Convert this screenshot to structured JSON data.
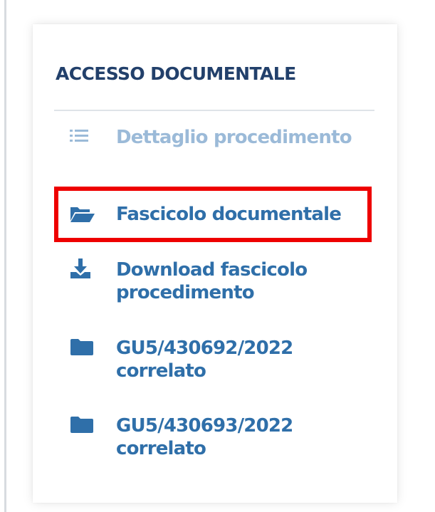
{
  "panel": {
    "title": "ACCESSO DOCUMENTALE",
    "items": [
      {
        "label": "Dettaglio procedimento",
        "icon": "list-icon",
        "state": "disabled"
      },
      {
        "label": "Fascicolo documentale",
        "icon": "folder-open-icon",
        "state": "highlighted"
      },
      {
        "label": "Download fascicolo procedimento",
        "icon": "download-icon",
        "state": "normal"
      },
      {
        "label": "GU5/430692/2022 correlato",
        "icon": "folder-icon",
        "state": "normal"
      },
      {
        "label": "GU5/430693/2022 correlato",
        "icon": "folder-icon",
        "state": "normal"
      }
    ]
  },
  "colors": {
    "title": "#22406b",
    "link": "#2f6fa9",
    "disabled": "#9bbad8",
    "highlight": "#ee0000",
    "divider": "#dfe3e8"
  }
}
